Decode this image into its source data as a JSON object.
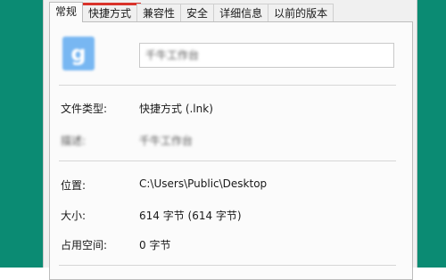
{
  "backdrop_color": "#0b8b73",
  "tabs": [
    {
      "label": "常规",
      "active": true
    },
    {
      "label": "快捷方式",
      "highlighted": true
    },
    {
      "label": "兼容性"
    },
    {
      "label": "安全"
    },
    {
      "label": "详细信息"
    },
    {
      "label": "以前的版本"
    }
  ],
  "highlight_color": "#d9332b",
  "general": {
    "icon_glyph": "g",
    "file_name": "千牛工作台",
    "file_type_label": "文件类型:",
    "file_type_value": "快捷方式 (.lnk)",
    "description_label": "描述:",
    "description_value": "千牛工作台",
    "location_label": "位置:",
    "location_value": "C:\\Users\\Public\\Desktop",
    "size_label": "大小:",
    "size_value": "614 字节 (614 字节)",
    "size_on_disk_label": "占用空间:",
    "size_on_disk_value": "0 字节"
  }
}
